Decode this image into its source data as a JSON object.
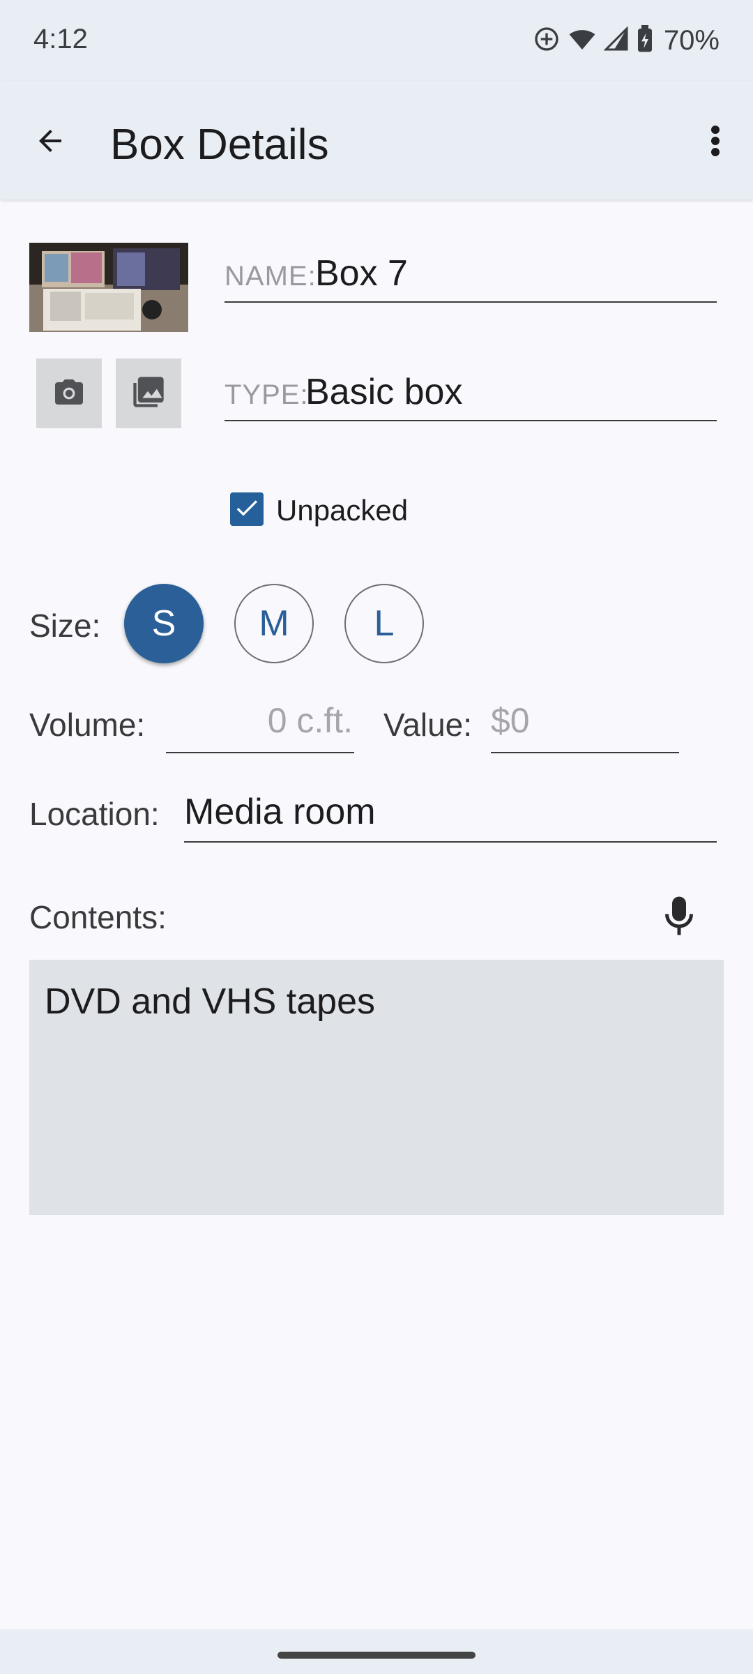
{
  "status_bar": {
    "time": "4:12",
    "battery_percent": "70%",
    "icons": [
      "sync-status-icon",
      "wifi-icon",
      "cell-signal-icon",
      "battery-charging-icon"
    ]
  },
  "app_bar": {
    "title": "Box Details",
    "back_icon": "arrow-back-icon",
    "menu_icon": "more-vert-icon"
  },
  "photo": {
    "thumbnail_icon": "box-photo-thumbnail",
    "camera_icon": "camera-icon",
    "gallery_icon": "gallery-icon"
  },
  "name_field": {
    "label": "NAME:",
    "value": "Box 7"
  },
  "type_field": {
    "label": "TYPE:",
    "value": "Basic box"
  },
  "unpacked": {
    "label": "Unpacked",
    "checked": true
  },
  "size": {
    "label": "Size:",
    "options": [
      "S",
      "M",
      "L"
    ],
    "selected": "S"
  },
  "volume": {
    "label": "Volume:",
    "placeholder": "0 c.ft."
  },
  "value": {
    "label": "Value:",
    "placeholder": "$0"
  },
  "location": {
    "label": "Location:",
    "value": "Media room"
  },
  "contents": {
    "label": "Contents:",
    "mic_icon": "microphone-icon",
    "text": "DVD and VHS tapes"
  },
  "colors": {
    "accent": "#2a5f97",
    "app_bar": "#e8eef4",
    "background": "#f9f9fd",
    "contents_bg": "#dfe2e6"
  }
}
